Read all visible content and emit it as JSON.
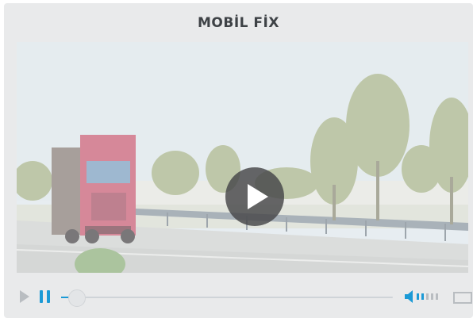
{
  "player": {
    "title": "MOBİL FİX"
  },
  "controls": {
    "progress_fraction": 0.0,
    "volume_level_bars_filled": 2,
    "volume_level_bars_total": 5
  },
  "colors": {
    "accent": "#1b9ad6",
    "card_background": "#e9eaeb",
    "title_text": "#3e4246",
    "overlay_button": "#464648"
  },
  "icons": {
    "big_play": "play-icon",
    "small_play": "play-icon",
    "pause": "pause-icon",
    "volume": "volume-icon",
    "fullscreen": "fullscreen-icon"
  }
}
